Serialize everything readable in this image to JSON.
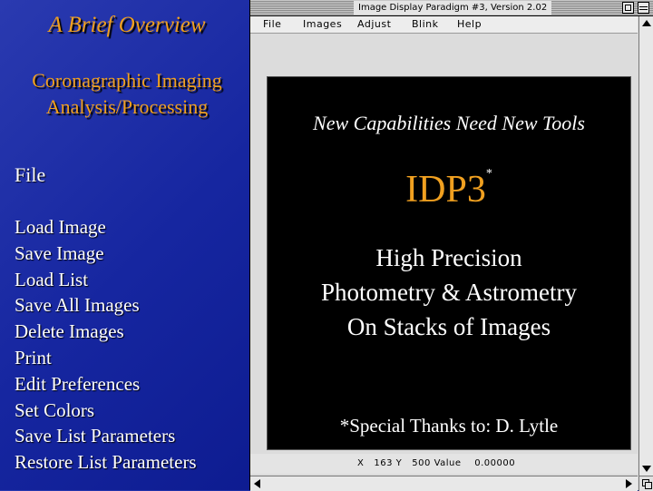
{
  "slide": {
    "title": "A Brief Overview",
    "subtitle_line1": "Coronagraphic Imaging",
    "subtitle_line2": "Analysis/Processing",
    "file_heading": "File",
    "file_items": [
      "Load Image",
      "Save Image",
      "Load List",
      "Save All Images",
      "Delete Images",
      "Print",
      "Edit Preferences",
      "Set Colors",
      "Save List Parameters",
      "Restore List Parameters"
    ],
    "colors": {
      "title_accent": "#f0a020",
      "background": "#1626a0",
      "text": "#ffffff"
    }
  },
  "window": {
    "title": "Image Display Paradigm #3, Version 2.02",
    "menu": [
      "File",
      "Images",
      "Adjust",
      "Blink",
      "Help"
    ],
    "canvas": {
      "heading": "New Capabilities Need New Tools",
      "product": "IDP3",
      "product_mark": "*",
      "desc_line1": "High Precision",
      "desc_line2": "Photometry & Astrometry",
      "desc_line3": "On Stacks of Images",
      "thanks": "*Special Thanks to: D. Lytle"
    },
    "status": "X   163 Y   500 Value    0.00000",
    "icons": {
      "zoom": "zoom-box-icon",
      "collapse": "collapse-box-icon",
      "scroll_up": "scroll-up-arrow-icon",
      "scroll_down": "scroll-down-arrow-icon",
      "scroll_left": "scroll-left-arrow-icon",
      "scroll_right": "scroll-right-arrow-icon",
      "grow": "grow-box-icon"
    }
  }
}
